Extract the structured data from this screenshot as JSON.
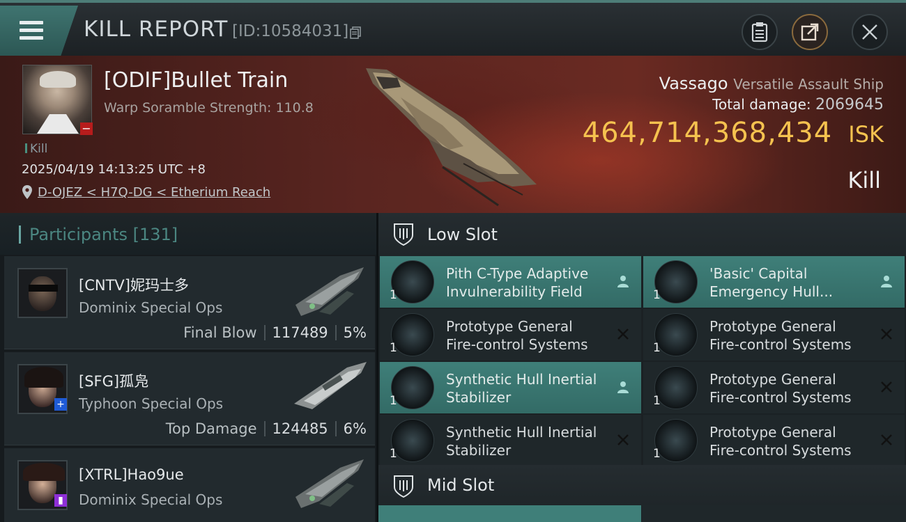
{
  "header": {
    "title": "KILL REPORT",
    "report_id": "[ID:10584031]",
    "icons": [
      "menu-icon",
      "copy-icon",
      "clipboard-icon",
      "share-icon",
      "close-icon"
    ]
  },
  "victim": {
    "pilot": "[ODIF]Bullet Train",
    "warp_scramble": "Warp Soramble Strength: 110.8",
    "tag": "Kill",
    "datetime": "2025/04/19 14:13:25 UTC +8",
    "location": "D-OJEZ < H7Q-DG < Etherium Reach",
    "ship_name": "Vassago",
    "ship_class": "Versatile Assault Ship",
    "damage_label": "Total damage:",
    "damage_value": "2069645",
    "isk_value": "464,714,368,434",
    "isk_unit": "ISK",
    "result": "Kill"
  },
  "participants": {
    "title": "Participants",
    "count": "[131]",
    "rows": [
      {
        "name": "[CNTV]妮玛士多",
        "ship": "Dominix Special Ops",
        "role": "Final Blow",
        "damage": "117489",
        "percent": "5%"
      },
      {
        "name": "[SFG]孤凫",
        "ship": "Typhoon Special Ops",
        "role": "Top Damage",
        "damage": "124485",
        "percent": "6%"
      },
      {
        "name": "[XTRL]Hao9ue",
        "ship": "Dominix Special Ops",
        "role": "",
        "damage": "",
        "percent": ""
      }
    ]
  },
  "slots": {
    "low_title": "Low Slot",
    "mid_title": "Mid Slot",
    "modules": [
      {
        "qty": "1",
        "line1": "Pith C-Type Adaptive",
        "line2": "Invulnerability Field",
        "state": "dropped",
        "active": true
      },
      {
        "qty": "1",
        "line1": "'Basic' Capital",
        "line2": "Emergency Hull...",
        "state": "dropped",
        "active": true
      },
      {
        "qty": "1",
        "line1": "Prototype General",
        "line2": "Fire-control Systems",
        "state": "destroyed",
        "active": false
      },
      {
        "qty": "1",
        "line1": "Prototype General",
        "line2": "Fire-control Systems",
        "state": "destroyed",
        "active": false
      },
      {
        "qty": "1",
        "line1": "Synthetic Hull Inertial",
        "line2": "Stabilizer",
        "state": "dropped",
        "active": true
      },
      {
        "qty": "1",
        "line1": "Prototype General",
        "line2": "Fire-control Systems",
        "state": "destroyed",
        "active": false
      },
      {
        "qty": "1",
        "line1": "Synthetic Hull Inertial",
        "line2": "Stabilizer",
        "state": "destroyed",
        "active": false
      },
      {
        "qty": "1",
        "line1": "Prototype General",
        "line2": "Fire-control Systems",
        "state": "destroyed",
        "active": false
      }
    ]
  }
}
